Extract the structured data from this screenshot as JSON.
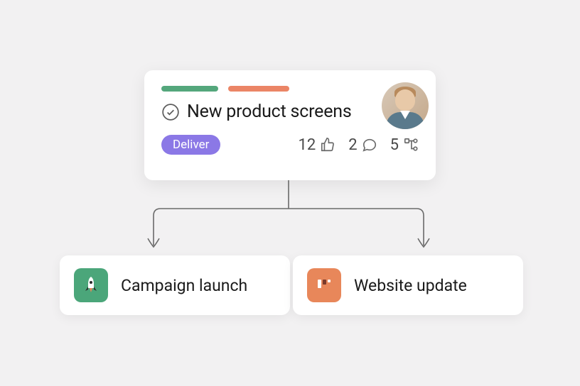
{
  "parent": {
    "title": "New product screens",
    "badge": "Deliver",
    "tags": [
      {
        "color": "#54a77c",
        "width": 80
      },
      {
        "color": "#eb8566",
        "width": 86
      }
    ],
    "stats": {
      "likes": 12,
      "comments": 2,
      "subtasks": 5
    }
  },
  "children": [
    {
      "title": "Campaign launch",
      "icon": "rocket",
      "icon_bg": "green"
    },
    {
      "title": "Website update",
      "icon": "board",
      "icon_bg": "orange"
    }
  ]
}
